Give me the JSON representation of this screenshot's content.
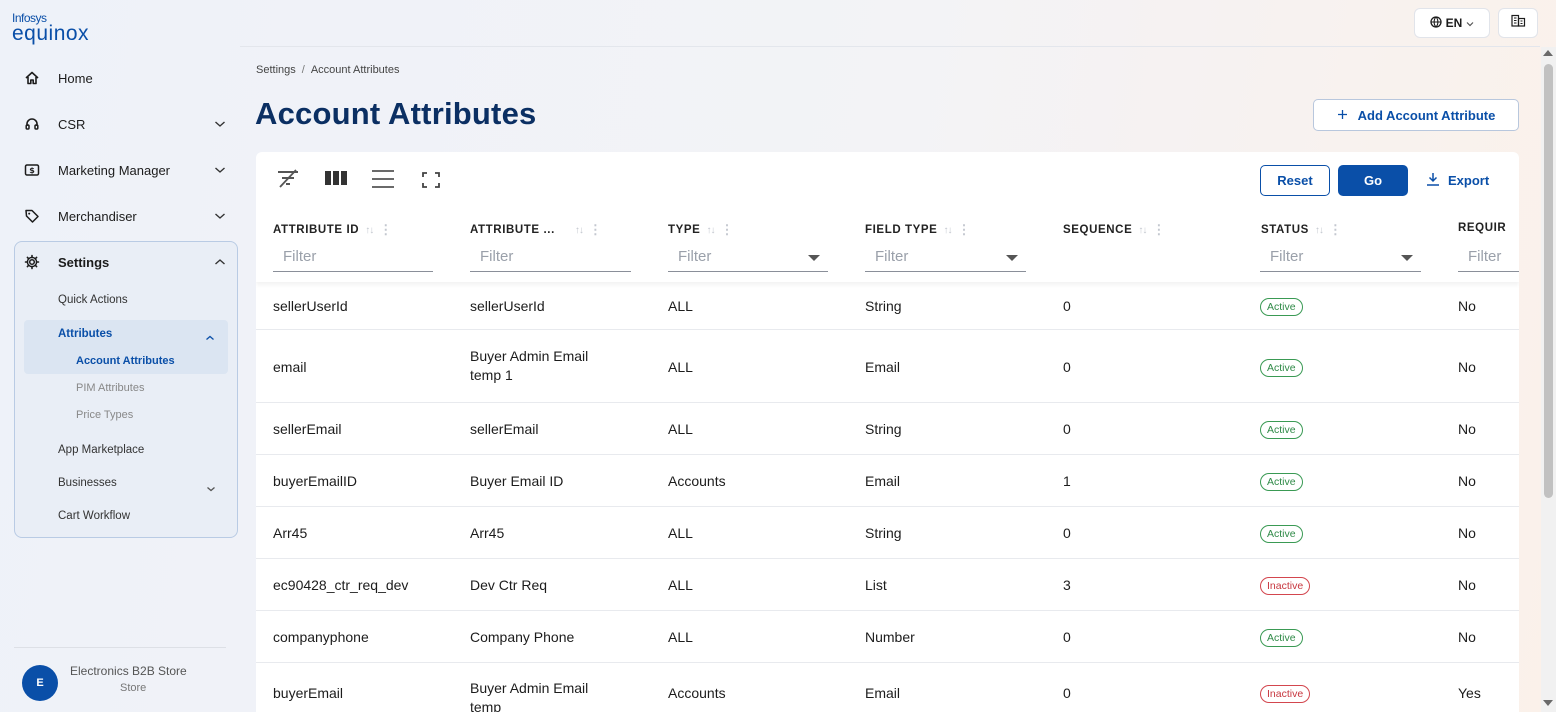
{
  "brand": {
    "line1": "Infosys",
    "line2": "equinox"
  },
  "sidebar": {
    "items": [
      {
        "label": "Home",
        "icon": "home-icon",
        "expandable": false
      },
      {
        "label": "CSR",
        "icon": "headset-icon",
        "expandable": true
      },
      {
        "label": "Marketing Manager",
        "icon": "dollar-icon",
        "expandable": true
      },
      {
        "label": "Merchandiser",
        "icon": "tag-icon",
        "expandable": true
      },
      {
        "label": "Settings",
        "icon": "gear-icon",
        "expandable": true,
        "expanded": true
      }
    ],
    "settings_children": {
      "quick_actions": "Quick Actions",
      "attributes": "Attributes",
      "attributes_children": [
        "Account Attributes",
        "PIM Attributes",
        "Price Types"
      ],
      "app_marketplace": "App Marketplace",
      "businesses": "Businesses",
      "cart_workflow": "Cart Workflow"
    },
    "store": {
      "avatar": "E",
      "name": "Electronics B2B Store",
      "type": "Store"
    }
  },
  "header": {
    "language": "EN",
    "breadcrumb": [
      "Settings",
      "Account Attributes"
    ],
    "title": "Account Attributes",
    "add_button": "Add Account Attribute"
  },
  "toolbar": {
    "reset": "Reset",
    "go": "Go",
    "export": "Export"
  },
  "table": {
    "filter_placeholder": "Filter",
    "columns": [
      {
        "label": "ATTRIBUTE ID",
        "sortable": true,
        "filter": "text"
      },
      {
        "label": "ATTRIBUTE ...",
        "sortable": true,
        "filter": "text"
      },
      {
        "label": "TYPE",
        "sortable": true,
        "filter": "select"
      },
      {
        "label": "FIELD TYPE",
        "sortable": true,
        "filter": "select"
      },
      {
        "label": "SEQUENCE",
        "sortable": true,
        "filter": "none"
      },
      {
        "label": "STATUS",
        "sortable": true,
        "filter": "select"
      },
      {
        "label": "REQUIR",
        "sortable": false,
        "filter": "text"
      }
    ],
    "rows": [
      {
        "id": "sellerUserId",
        "name": "sellerUserId",
        "type": "ALL",
        "field_type": "String",
        "sequence": "0",
        "status": "Active",
        "required": "No"
      },
      {
        "id": "email",
        "name": "Buyer Admin Email temp 1",
        "type": "ALL",
        "field_type": "Email",
        "sequence": "0",
        "status": "Active",
        "required": "No"
      },
      {
        "id": "sellerEmail",
        "name": "sellerEmail",
        "type": "ALL",
        "field_type": "String",
        "sequence": "0",
        "status": "Active",
        "required": "No"
      },
      {
        "id": "buyerEmailID",
        "name": "Buyer Email ID",
        "type": "Accounts",
        "field_type": "Email",
        "sequence": "1",
        "status": "Active",
        "required": "No"
      },
      {
        "id": "Arr45",
        "name": "Arr45",
        "type": "ALL",
        "field_type": "String",
        "sequence": "0",
        "status": "Active",
        "required": "No"
      },
      {
        "id": "ec90428_ctr_req_dev",
        "name": "Dev Ctr Req",
        "type": "ALL",
        "field_type": "List",
        "sequence": "3",
        "status": "Inactive",
        "required": "No"
      },
      {
        "id": "companyphone",
        "name": "Company Phone",
        "type": "ALL",
        "field_type": "Number",
        "sequence": "0",
        "status": "Active",
        "required": "No"
      },
      {
        "id": "buyerEmail",
        "name": "Buyer Admin Email temp",
        "type": "Accounts",
        "field_type": "Email",
        "sequence": "0",
        "status": "Inactive",
        "required": "Yes"
      }
    ]
  },
  "colors": {
    "brand_blue": "#0a4fa8",
    "title_navy": "#0b2f63",
    "active_green": "#2f8a47",
    "inactive_red": "#c7363e"
  }
}
